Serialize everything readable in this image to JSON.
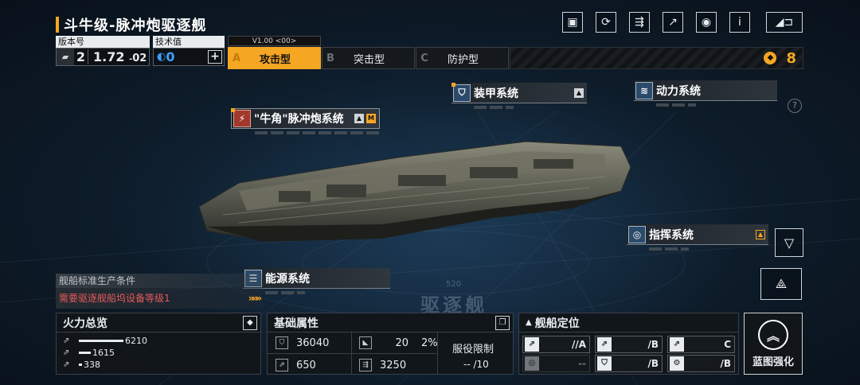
{
  "title": "斗牛级-脉冲炮驱逐舰",
  "version": {
    "label": "版本号",
    "main": "2",
    "value": "1.72",
    "sub": "02"
  },
  "tech": {
    "label": "技术值",
    "value": "0",
    "plus": "+"
  },
  "mode_version": "V1.00 <00>",
  "modes": [
    {
      "letter": "A",
      "label": "攻击型"
    },
    {
      "letter": "B",
      "label": "突击型"
    },
    {
      "letter": "C",
      "label": "防护型"
    }
  ],
  "currency": "8",
  "top_icons": [
    "gallery-icon",
    "refresh-icon",
    "share-icon",
    "export-icon",
    "view-icon",
    "info-icon"
  ],
  "info_glyph": "i",
  "help_glyph": "?",
  "systems": {
    "weapon": {
      "label": "\"牛角\"脉冲炮系统",
      "badge": "M"
    },
    "armor": {
      "label": "装甲系统"
    },
    "power": {
      "label": "动力系统"
    },
    "command": {
      "label": "指挥系统"
    },
    "energy": {
      "label": "能源系统"
    }
  },
  "production": {
    "title": "舰船标准生产条件",
    "requirement": "需要驱逐舰船坞设备等级1",
    "arrows": "»»»",
    "color": "#e65a5a"
  },
  "background_text": "驱逐舰",
  "background_number": "520",
  "firepower": {
    "title": "火力总览",
    "rows": [
      {
        "icon": "anti-ship-icon",
        "value": 6210,
        "label": "6210"
      },
      {
        "icon": "anti-aircraft-icon",
        "value": 1615,
        "label": "1615"
      },
      {
        "icon": "siege-icon",
        "value": 338,
        "label": "338"
      }
    ],
    "max": 6210
  },
  "base_attributes": {
    "title": "基础属性",
    "hp": "36040",
    "armor": "20",
    "armor_pct": "2%",
    "speed": "650",
    "warp": "3250",
    "service_label": "服役限制",
    "service_value": "-- /10"
  },
  "positioning": {
    "title": "舰船定位",
    "cells": [
      {
        "value": "//A",
        "dim": false
      },
      {
        "value": "/B",
        "dim": false
      },
      {
        "value": "C",
        "dim": false
      },
      {
        "value": "--",
        "dim": true
      },
      {
        "value": "/B",
        "dim": false
      },
      {
        "value": "/B",
        "dim": false
      }
    ]
  },
  "enhance": {
    "label": "蓝图强化"
  },
  "colors": {
    "accent": "#f5a623",
    "blue": "#3da0ff",
    "danger": "#e65a5a"
  }
}
